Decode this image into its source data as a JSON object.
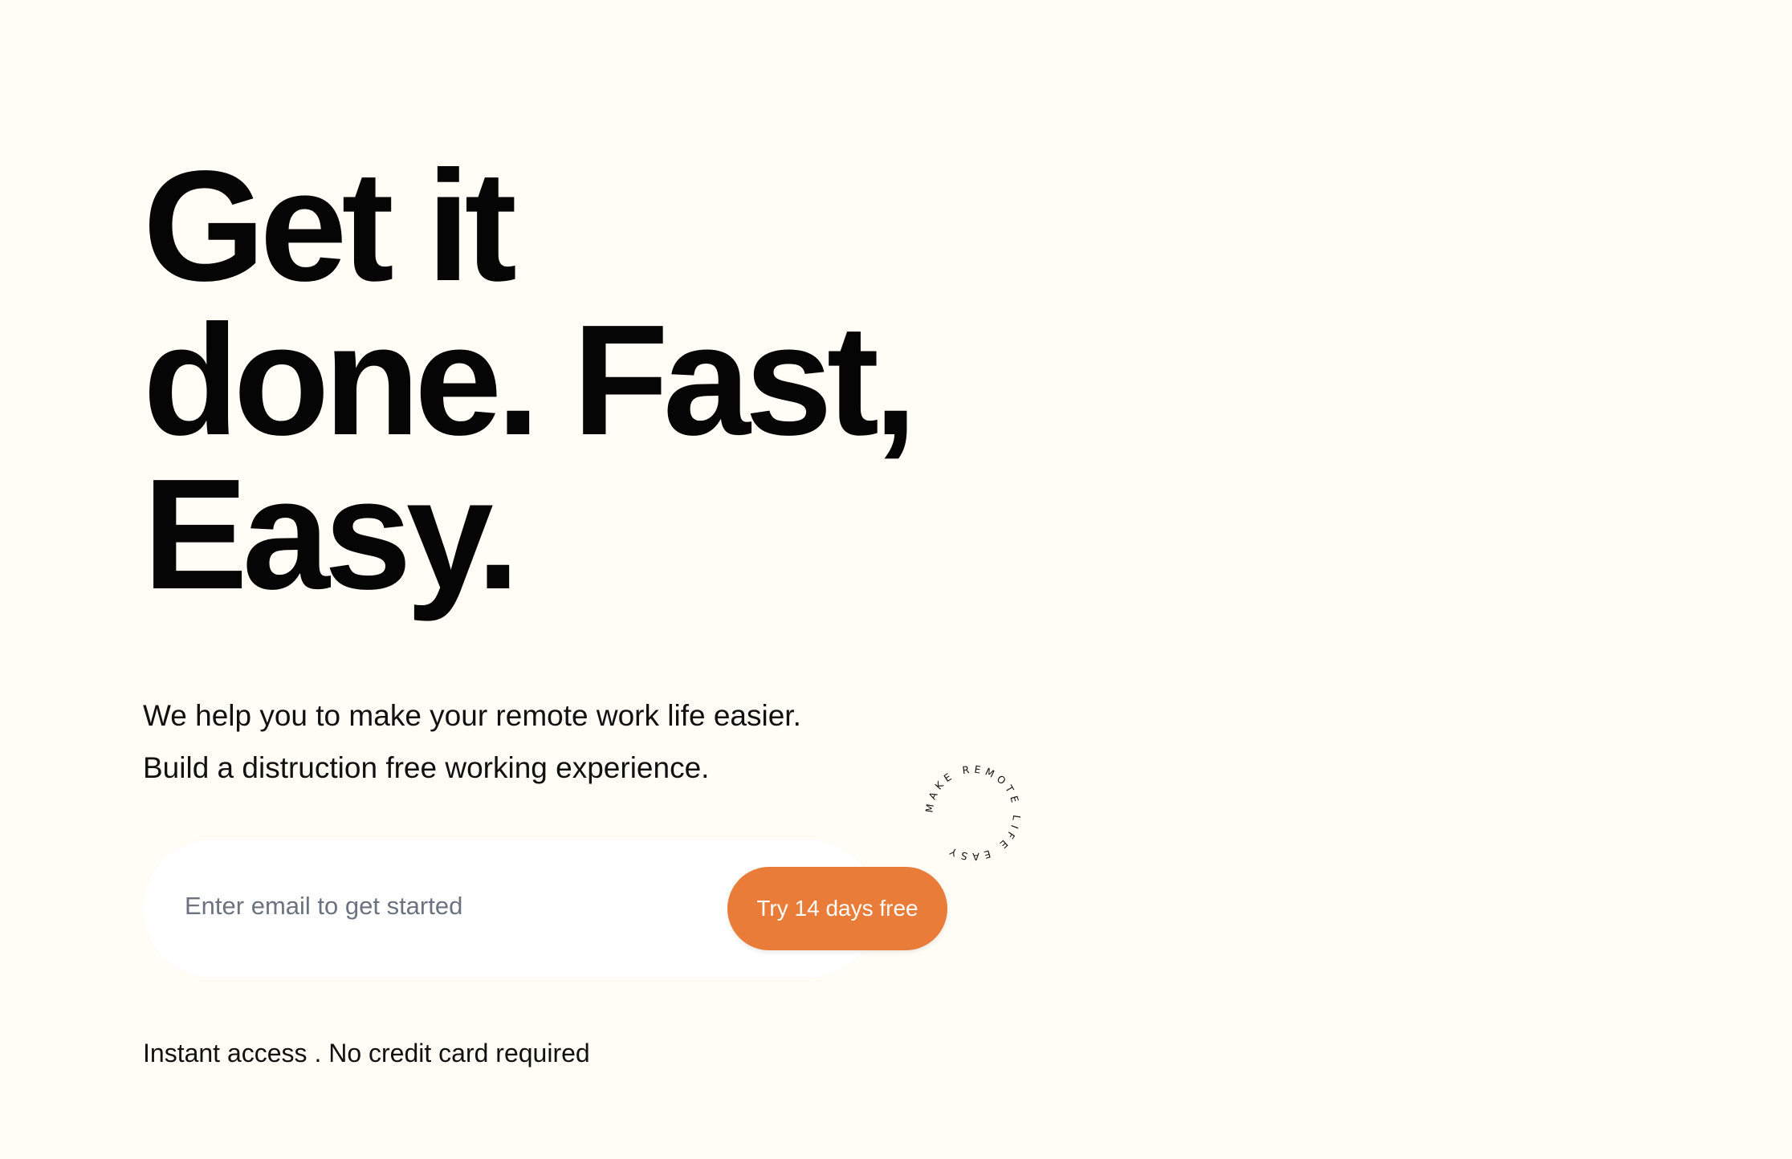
{
  "hero": {
    "headline_lines": [
      "Get it",
      "done. Fast,",
      "Easy."
    ],
    "subcopy_lines": [
      "We help you to make your remote work life easier.",
      "Build a distruction free working experience."
    ]
  },
  "signup": {
    "email_placeholder": "Enter email to get started",
    "cta_label": "Try 14 days free"
  },
  "badge": {
    "text": "MAKE REMOTE LIFE EASY"
  },
  "footnote": "Instant access . No credit card required",
  "colors": {
    "background": "#fffdf6",
    "accent": "#e97c38",
    "text": "#050505"
  }
}
